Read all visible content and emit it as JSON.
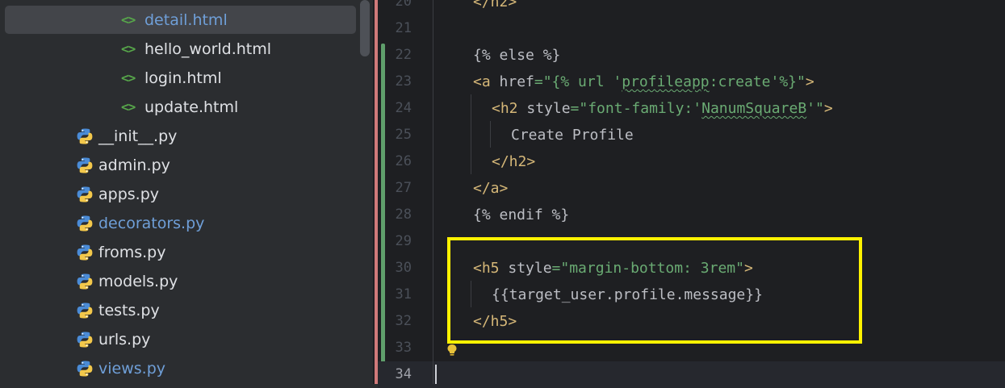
{
  "tree": {
    "selected": "detail.html",
    "items": [
      {
        "label": "detail.html",
        "type": "html",
        "vcs": true
      },
      {
        "label": "hello_world.html",
        "type": "html",
        "vcs": false
      },
      {
        "label": "login.html",
        "type": "html",
        "vcs": false
      },
      {
        "label": "update.html",
        "type": "html",
        "vcs": false
      },
      {
        "label": "__init__.py",
        "type": "python",
        "vcs": false
      },
      {
        "label": "admin.py",
        "type": "python",
        "vcs": false
      },
      {
        "label": "apps.py",
        "type": "python",
        "vcs": false
      },
      {
        "label": "decorators.py",
        "type": "python",
        "vcs": true
      },
      {
        "label": "froms.py",
        "type": "python",
        "vcs": false
      },
      {
        "label": "models.py",
        "type": "python",
        "vcs": false
      },
      {
        "label": "tests.py",
        "type": "python",
        "vcs": false
      },
      {
        "label": "urls.py",
        "type": "python",
        "vcs": false
      },
      {
        "label": "views.py",
        "type": "python",
        "vcs": true
      }
    ],
    "html_icon_glyph": "<>"
  },
  "editor": {
    "current_line": "34",
    "lines": [
      {
        "num": "20",
        "tokens": [
          {
            "t": "</h2>",
            "c": "tag"
          }
        ]
      },
      {
        "num": "21",
        "tokens": []
      },
      {
        "num": "22",
        "tokens": [
          {
            "t": "{% else %}",
            "c": "tpl"
          }
        ]
      },
      {
        "num": "23",
        "tokens": [
          {
            "t": "<a ",
            "c": "tag"
          },
          {
            "t": "href",
            "c": "attr"
          },
          {
            "t": "=\"{% url '",
            "c": "str"
          },
          {
            "t": "profileapp",
            "c": "str-squig"
          },
          {
            "t": ":create'%}\"",
            "c": "str"
          },
          {
            "t": ">",
            "c": "tag"
          }
        ]
      },
      {
        "num": "24",
        "tokens": [
          {
            "t": "<h2 ",
            "c": "tag"
          },
          {
            "t": "style",
            "c": "attr"
          },
          {
            "t": "=\"font-family:'",
            "c": "str"
          },
          {
            "t": "NanumSquareB",
            "c": "str-squig"
          },
          {
            "t": "'\"",
            "c": "str"
          },
          {
            "t": ">",
            "c": "tag"
          }
        ]
      },
      {
        "num": "25",
        "tokens": [
          {
            "t": "Create Profile",
            "c": "text"
          }
        ]
      },
      {
        "num": "26",
        "tokens": [
          {
            "t": "</h2>",
            "c": "tag"
          }
        ]
      },
      {
        "num": "27",
        "tokens": [
          {
            "t": "</a>",
            "c": "tag"
          }
        ]
      },
      {
        "num": "28",
        "tokens": [
          {
            "t": "{% endif %}",
            "c": "tpl"
          }
        ]
      },
      {
        "num": "29",
        "tokens": []
      },
      {
        "num": "30",
        "tokens": [
          {
            "t": "<h5 ",
            "c": "tag"
          },
          {
            "t": "style",
            "c": "attr"
          },
          {
            "t": "=\"margin-bottom: 3rem\"",
            "c": "str"
          },
          {
            "t": ">",
            "c": "tag"
          }
        ]
      },
      {
        "num": "31",
        "tokens": [
          {
            "t": "{{target_user.profile.message}}",
            "c": "tpl"
          }
        ]
      },
      {
        "num": "32",
        "tokens": [
          {
            "t": "</h5>",
            "c": "tag"
          }
        ]
      },
      {
        "num": "33",
        "tokens": []
      },
      {
        "num": "34",
        "tokens": []
      }
    ]
  },
  "colors": {
    "highlight_box": "#fff200",
    "tag": "#d5b778",
    "string": "#6aab73",
    "vcs_modified": "#6f9fd8",
    "gutter_added": "#5f9e6b",
    "gutter_removed": "#d07a7a"
  }
}
